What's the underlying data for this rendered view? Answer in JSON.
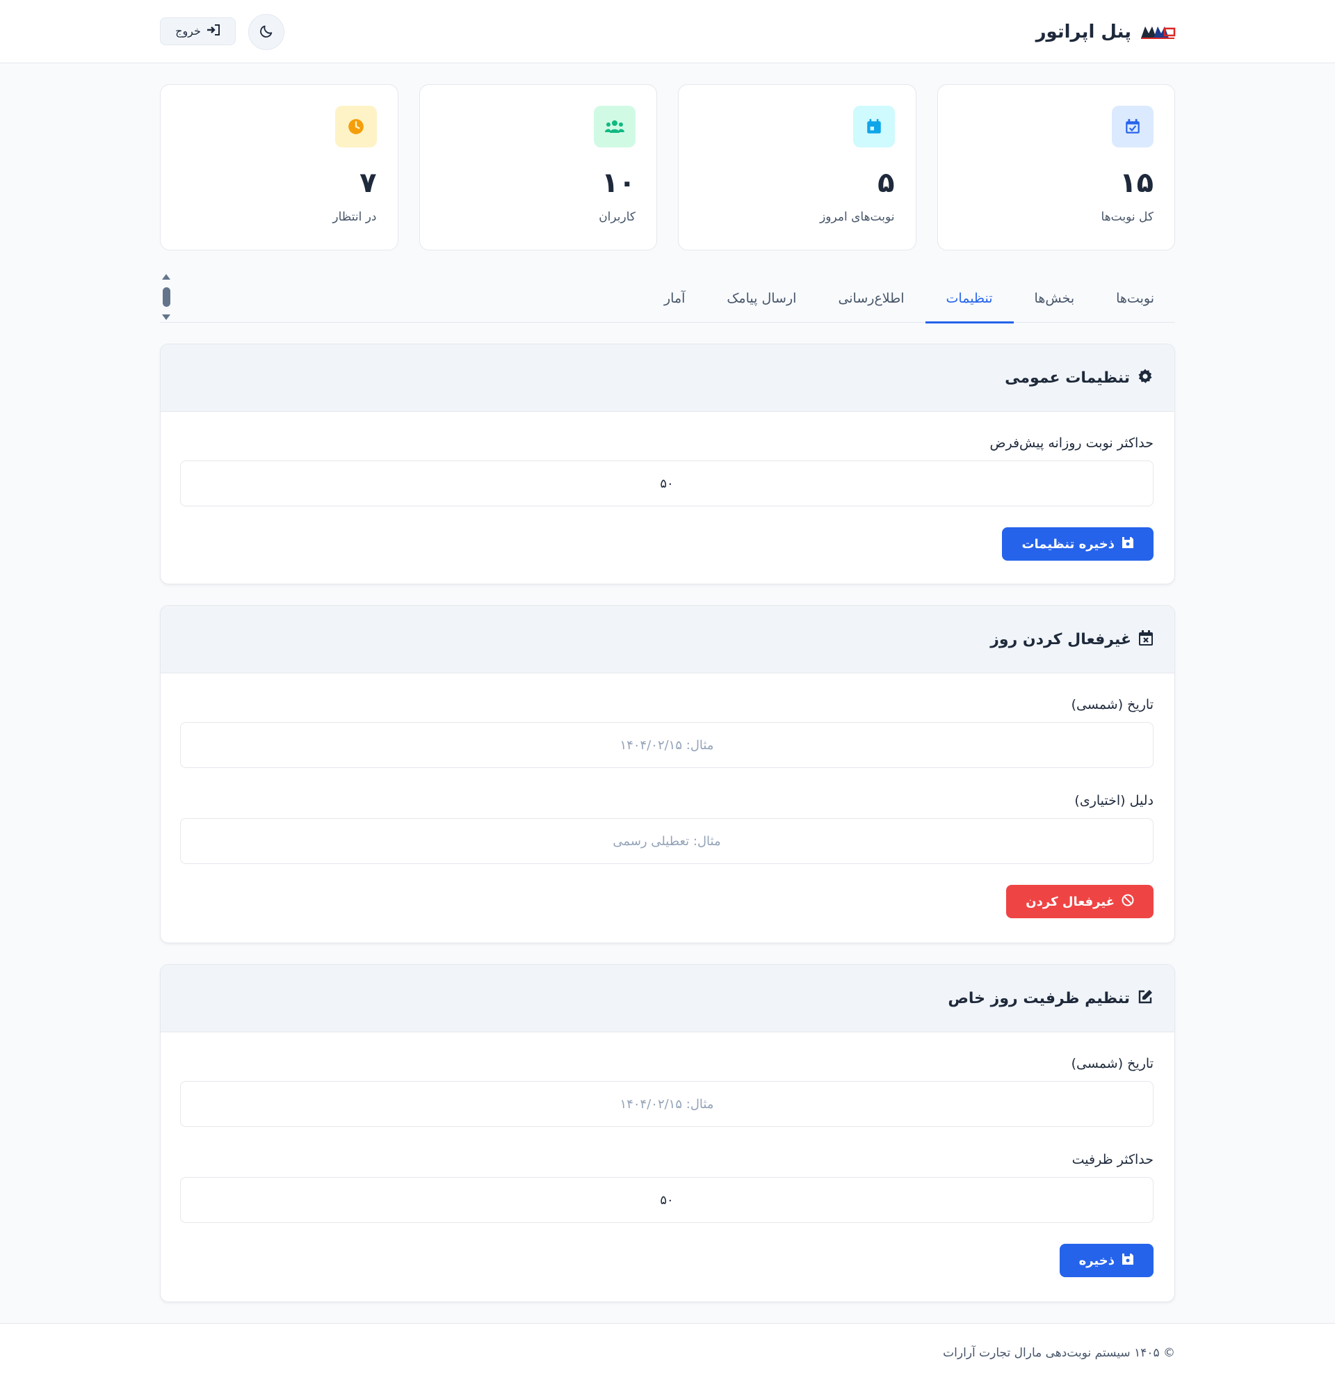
{
  "header": {
    "title": "پنل اپراتور",
    "logout_label": "خروج",
    "logo_icon": "company-logo",
    "theme_icon": "moon-icon"
  },
  "stats": [
    {
      "label": "کل نوبت‌ها",
      "value": "۱۵",
      "icon": "calendar-check-icon",
      "icon_bg": "#dbeafe",
      "icon_color": "#2563eb"
    },
    {
      "label": "نوبت‌های امروز",
      "value": "۵",
      "icon": "calendar-day-icon",
      "icon_bg": "#cffafe",
      "icon_color": "#0ea5e9"
    },
    {
      "label": "کاربران",
      "value": "۱۰",
      "icon": "users-icon",
      "icon_bg": "#d1fae5",
      "icon_color": "#10b981"
    },
    {
      "label": "در انتظار",
      "value": "۷",
      "icon": "clock-icon",
      "icon_bg": "#fef3c7",
      "icon_color": "#f59e0b"
    }
  ],
  "tabs": [
    {
      "label": "نوبت‌ها",
      "active": false
    },
    {
      "label": "بخش‌ها",
      "active": false
    },
    {
      "label": "تنظیمات",
      "active": true
    },
    {
      "label": "اطلاع‌رسانی",
      "active": false
    },
    {
      "label": "ارسال پیامک",
      "active": false
    },
    {
      "label": "آمار",
      "active": false
    }
  ],
  "general_settings": {
    "title": "تنظیمات عمومی",
    "icon": "gear-icon",
    "field_label": "حداکثر نوبت روزانه پیش‌فرض",
    "field_value": "۵۰",
    "save_label": "ذخیره تنظیمات"
  },
  "disable_day": {
    "title": "غیرفعال کردن روز",
    "icon": "calendar-x-icon",
    "date_label": "تاریخ (شمسی)",
    "date_placeholder": "مثال: ۱۴۰۴/۰۲/۱۵",
    "reason_label": "دلیل (اختیاری)",
    "reason_placeholder": "مثال: تعطیلی رسمی",
    "submit_label": "غیرفعال کردن"
  },
  "special_capacity": {
    "title": "تنظیم ظرفیت روز خاص",
    "icon": "edit-icon",
    "date_label": "تاریخ (شمسی)",
    "date_placeholder": "مثال: ۱۴۰۴/۰۲/۱۵",
    "capacity_label": "حداکثر ظرفیت",
    "capacity_value": "۵۰",
    "save_label": "ذخیره"
  },
  "footer": {
    "text": "© ۱۴۰۵ سیستم نوبت‌دهی مارال تجارت آرارات"
  },
  "colors": {
    "primary": "#2563eb",
    "danger": "#ef4444",
    "text": "#1e293b",
    "muted": "#475569"
  }
}
